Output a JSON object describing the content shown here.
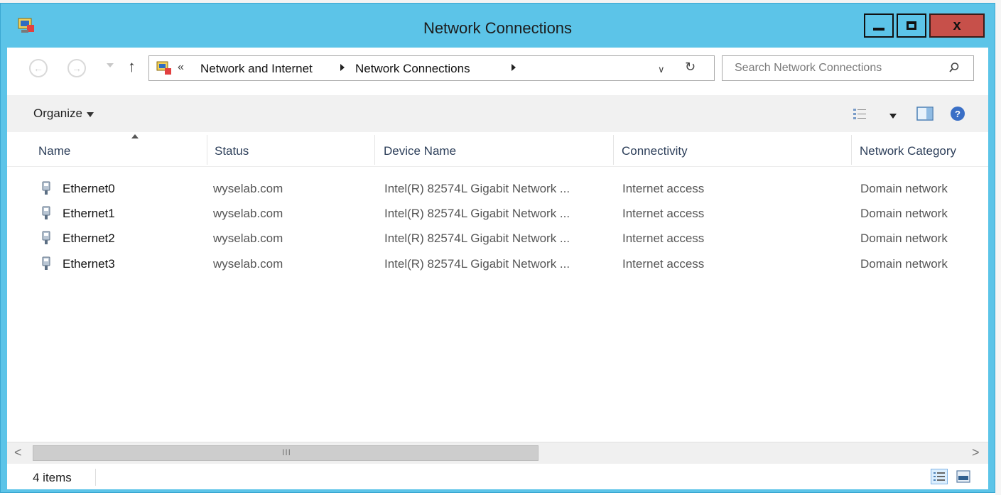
{
  "window": {
    "title": "Network Connections",
    "close_glyph": "x"
  },
  "nav": {
    "back_icon": "back-arrow-icon",
    "forward_icon": "forward-arrow-icon",
    "up_glyph": "↑",
    "address_prefix": "«",
    "breadcrumbs": [
      "Network and Internet",
      "Network Connections"
    ],
    "refresh_glyph": "↻"
  },
  "search": {
    "placeholder": "Search Network Connections"
  },
  "toolbar": {
    "organize_label": "Organize"
  },
  "columns": [
    "Name",
    "Status",
    "Device Name",
    "Connectivity",
    "Network Category"
  ],
  "rows": [
    {
      "name": "Ethernet0",
      "status": "wyselab.com",
      "device": "Intel(R) 82574L Gigabit Network ...",
      "connectivity": "Internet access",
      "category": "Domain network"
    },
    {
      "name": "Ethernet1",
      "status": "wyselab.com",
      "device": "Intel(R) 82574L Gigabit Network ...",
      "connectivity": "Internet access",
      "category": "Domain network"
    },
    {
      "name": "Ethernet2",
      "status": "wyselab.com",
      "device": "Intel(R) 82574L Gigabit Network ...",
      "connectivity": "Internet access",
      "category": "Domain network"
    },
    {
      "name": "Ethernet3",
      "status": "wyselab.com",
      "device": "Intel(R) 82574L Gigabit Network ...",
      "connectivity": "Internet access",
      "category": "Domain network"
    }
  ],
  "scrollbar": {
    "left_glyph": "<",
    "right_glyph": ">",
    "grip": "III"
  },
  "status": {
    "items_count": "4 items"
  },
  "colors": {
    "titlebar": "#5cc4e8",
    "close_button": "#c7504a"
  }
}
